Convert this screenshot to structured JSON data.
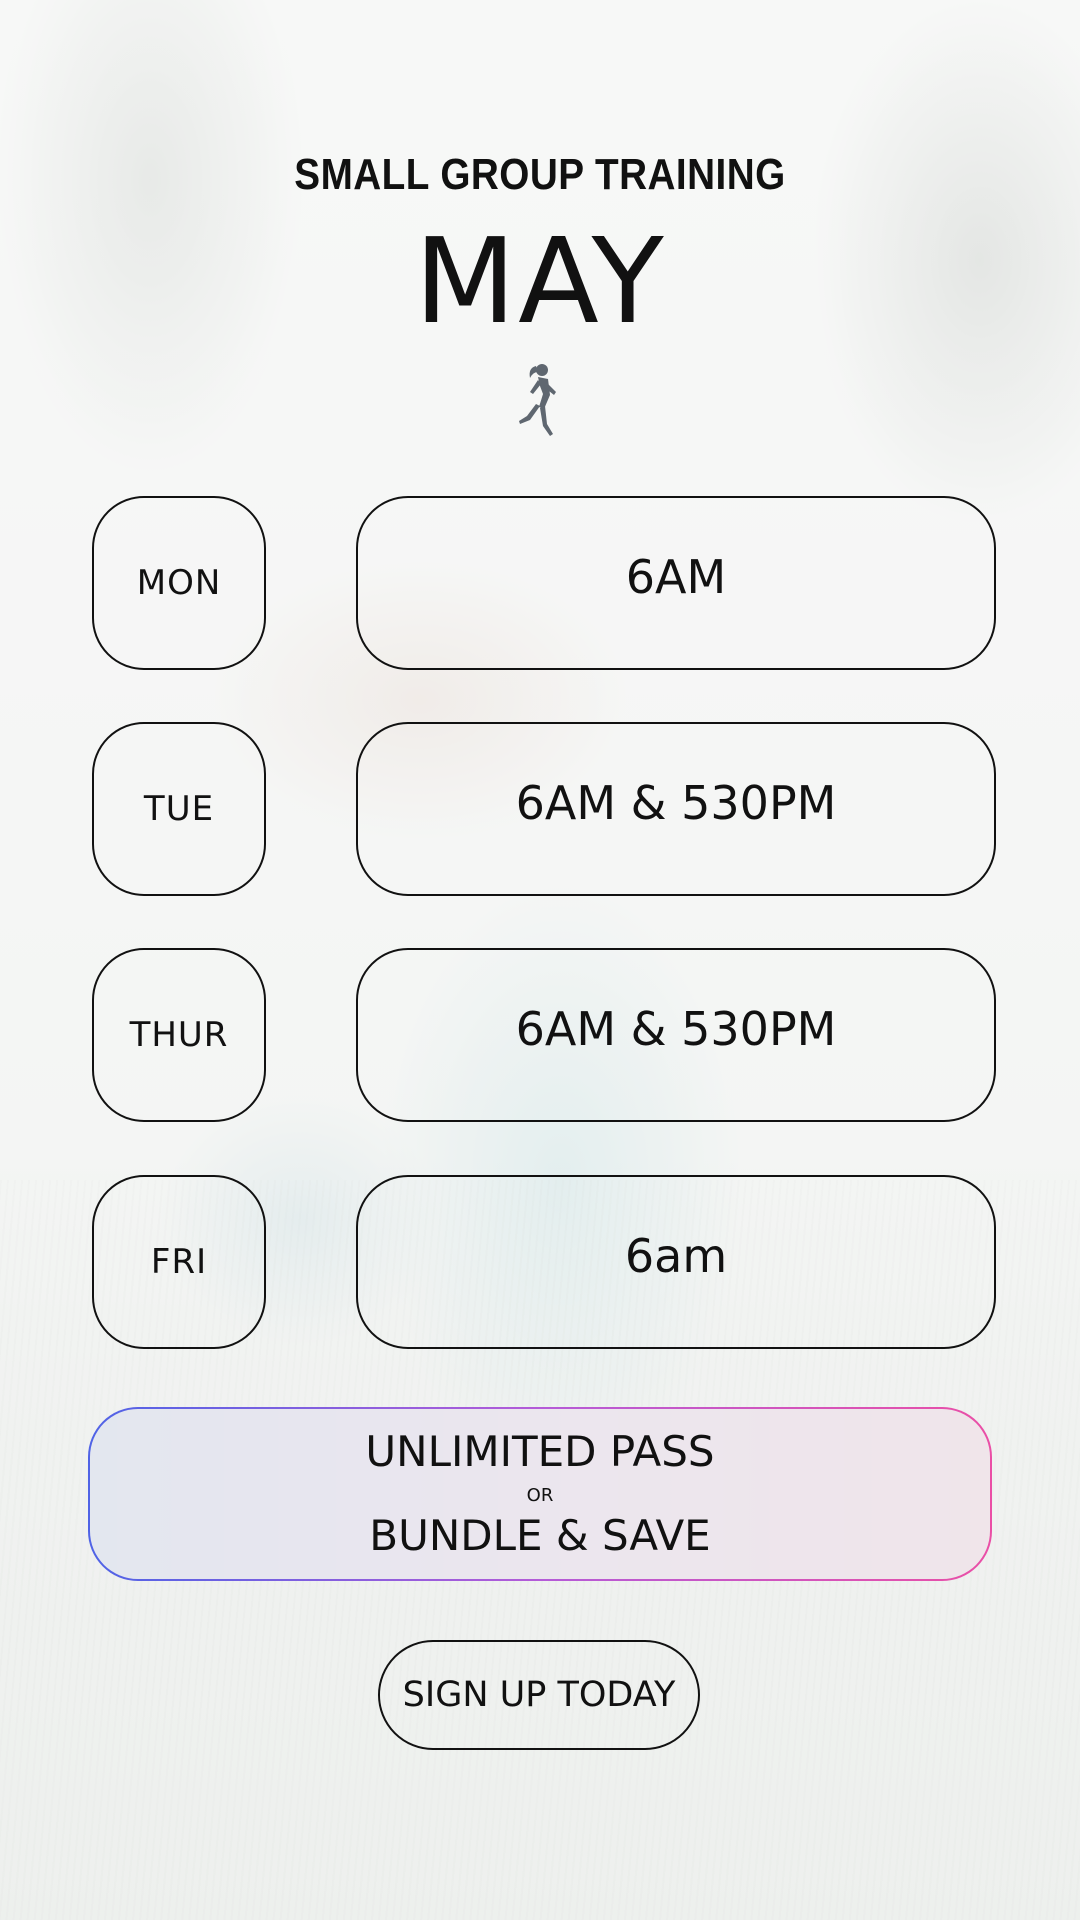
{
  "header": {
    "title": "SMALL GROUP TRAINING",
    "month": "MAY",
    "icon": "runner-icon"
  },
  "schedule": [
    {
      "day": "MON",
      "time": "6AM"
    },
    {
      "day": "TUE",
      "time": "6AM & 530PM"
    },
    {
      "day": "THUR",
      "time": "6AM & 530PM"
    },
    {
      "day": "FRI",
      "time": "6am"
    }
  ],
  "pass": {
    "line1": "UNLIMITED PASS",
    "separator": "OR",
    "line2": "BUNDLE & SAVE",
    "gradient_start": "#4f63e6",
    "gradient_end": "#ea4fa6"
  },
  "cta": {
    "label": "SIGN UP TODAY"
  }
}
